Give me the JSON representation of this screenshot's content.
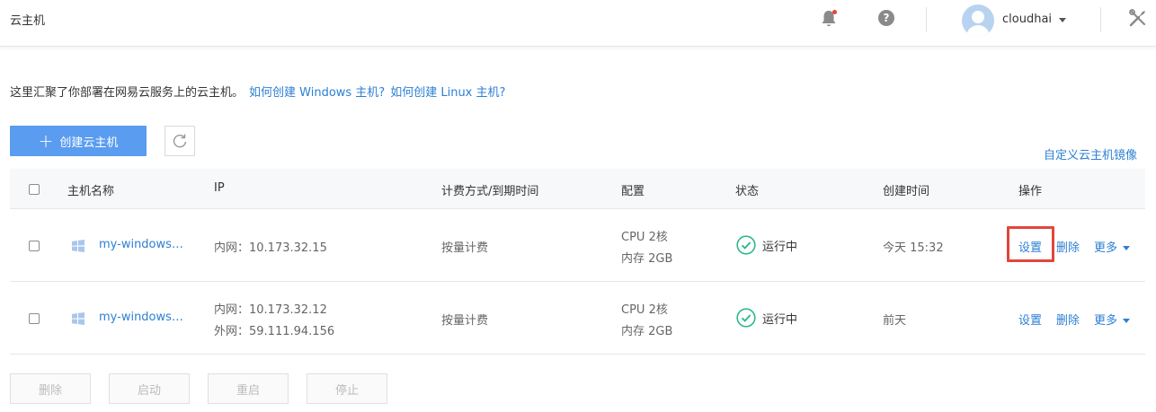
{
  "header": {
    "title": "云主机",
    "username": "cloudhai",
    "help_glyph": "?",
    "icons": [
      "bell-icon",
      "help-icon",
      "avatar",
      "tools-icon"
    ],
    "notification_dot_color": "#e2463b"
  },
  "intro": {
    "text": "这里汇聚了你部署在网易云服务上的云主机。",
    "link_windows": "如何创建 Windows 主机?",
    "link_linux": "如何创建 Linux 主机?"
  },
  "toolbar": {
    "create_label": "创建云主机",
    "custom_image_link": "自定义云主机镜像"
  },
  "table": {
    "headers": [
      "主机名称",
      "IP",
      "计费方式/到期时间",
      "配置",
      "状态",
      "创建时间",
      "操作"
    ],
    "rows": [
      {
        "name": "my-windows…",
        "ip_lines": [
          "内网：10.173.32.15"
        ],
        "billing": "按量计费",
        "config_lines": [
          "CPU 2核",
          "内存 2GB"
        ],
        "status": "运行中",
        "created": "今天 15:32",
        "ops": [
          "设置",
          "删除",
          "更多"
        ],
        "highlight_settings": true
      },
      {
        "name": "my-windows…",
        "ip_lines": [
          "内网：10.173.32.12",
          "外网：59.111.94.156"
        ],
        "billing": "按量计费",
        "config_lines": [
          "CPU 2核",
          "内存 2GB"
        ],
        "status": "运行中",
        "created": "前天",
        "ops": [
          "设置",
          "删除",
          "更多"
        ],
        "highlight_settings": false
      }
    ]
  },
  "bulk_actions": [
    "删除",
    "启动",
    "重启",
    "停止"
  ],
  "colors": {
    "accent": "#2d7fd3",
    "primary_button": "#5a9cf0",
    "status_ok": "#2bb98a",
    "highlight": "#e2463b"
  }
}
